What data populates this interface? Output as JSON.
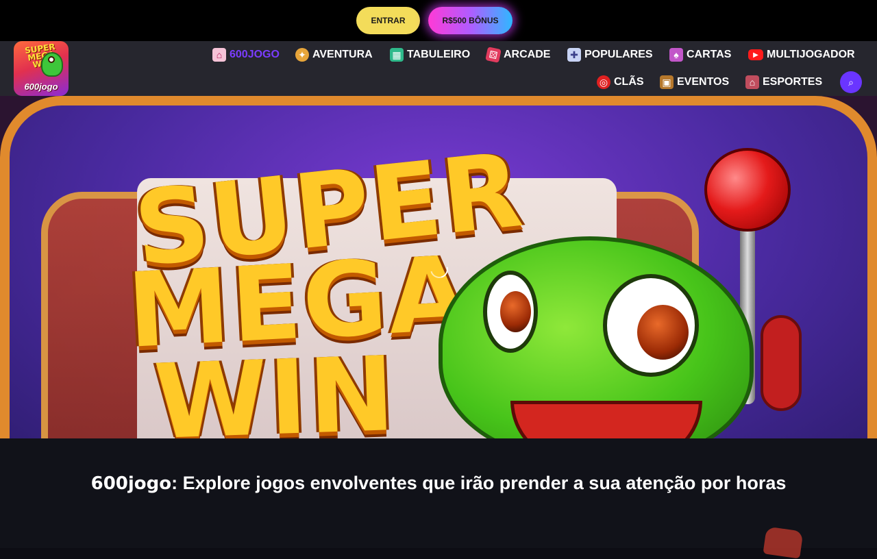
{
  "auth": {
    "login_label": "ENTRAR",
    "bonus_label": "R$500 BÔNUS"
  },
  "logo": {
    "title_lines": "SUPER MEGA WIN",
    "brand": "600jogo"
  },
  "nav": {
    "items": [
      {
        "label": "600JOGO",
        "icon": "home-icon",
        "active": true
      },
      {
        "label": "AVENTURA",
        "icon": "compass-icon",
        "active": false
      },
      {
        "label": "TABULEIRO",
        "icon": "board-game-icon",
        "active": false
      },
      {
        "label": "ARCADE",
        "icon": "dice-icon",
        "active": false
      },
      {
        "label": "POPULARES",
        "icon": "gamepad-icon",
        "active": false
      },
      {
        "label": "CARTAS",
        "icon": "cards-icon",
        "active": false
      },
      {
        "label": "MULTIJOGADOR",
        "icon": "youtube-icon",
        "active": false
      },
      {
        "label": "CLÃS",
        "icon": "lifebuoy-icon",
        "active": false
      },
      {
        "label": "EVENTOS",
        "icon": "treasure-icon",
        "active": false
      },
      {
        "label": "ESPORTES",
        "icon": "stadium-icon",
        "active": false
      }
    ],
    "active_color": "#7b3cff",
    "search_icon": "search-icon"
  },
  "hero": {
    "title_lines": [
      "SUPER",
      "MEGA",
      "WIN"
    ]
  },
  "caption": {
    "brand": "600jogo",
    "text": ": Explore jogos envolventes que irão prender a sua atenção por horas"
  },
  "colors": {
    "login_button": "#f3dc5a",
    "bonus_gradient_start": "#ff3ad6",
    "bonus_gradient_end": "#2fb8ff",
    "nav_bg": "#26262e",
    "search_button": "#6a35ff"
  }
}
